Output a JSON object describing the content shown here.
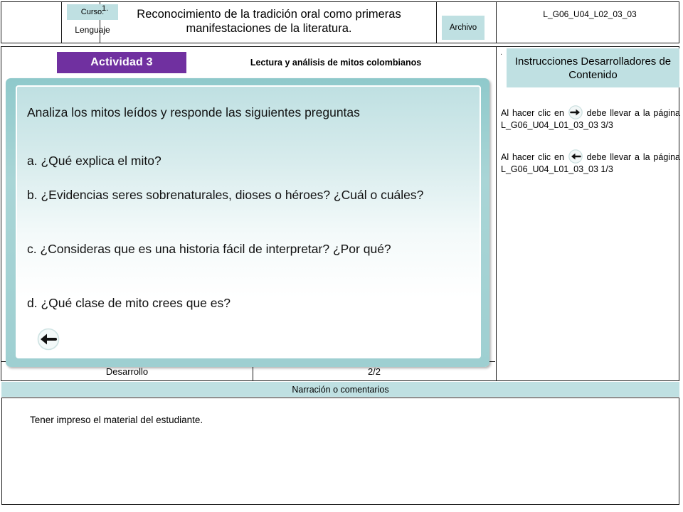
{
  "header": {
    "curso_label": "Curso:",
    "curso_value": "Lenguaje",
    "item_number": "1.",
    "title": "Reconocimiento de la tradición oral como primeras manifestaciones de la literatura.",
    "archivo_label": "Archivo",
    "file_code": "L_G06_U04_L02_03_03"
  },
  "activity": {
    "badge": "Actividad 3",
    "subtitle": "Lectura y análisis de mitos colombianos"
  },
  "instructions": {
    "marker": ".",
    "heading": "Instrucciones Desarrolladores de Contenido",
    "items": [
      {
        "before": "Al hacer clic en",
        "icon": "arrow-right-icon",
        "after": "debe llevar a la página L_G06_U04_L01_03_03 3/3"
      },
      {
        "before": "Al hacer clic en",
        "icon": "arrow-left-icon",
        "after": "debe llevar a la página L_G06_U04_L01_03_03 1/3"
      }
    ]
  },
  "content": {
    "intro": "Analiza los mitos leídos y responde las siguientes preguntas",
    "questions": [
      "a. ¿Qué explica el mito?",
      "b. ¿Evidencias seres sobrenaturales, dioses o héroes? ¿Cuál o cuáles?",
      "c. ¿Consideras que es una historia fácil de interpretar? ¿Por qué?",
      "d. ¿Qué clase de mito crees que es?"
    ],
    "back_button_icon": "arrow-left-icon"
  },
  "footer": {
    "section_label": "Desarrollo",
    "page_indicator": "2/2",
    "narration_band": "Narración o comentarios",
    "note": "Tener impreso el material del estudiante."
  },
  "colors": {
    "teal": "#bfe0e2",
    "purple": "#7030a0",
    "border": "#1a1a1a"
  }
}
